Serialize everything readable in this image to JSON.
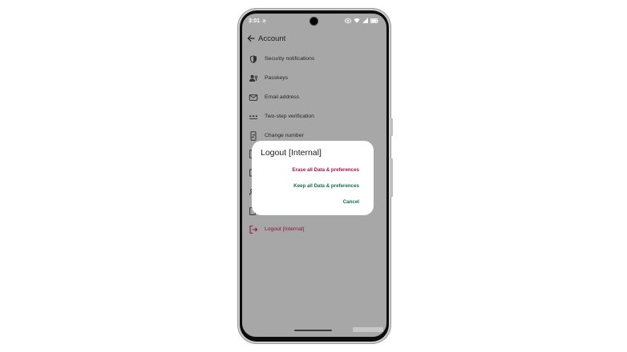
{
  "status_bar": {
    "time": "3:01",
    "notif_glyph": "≷"
  },
  "app_bar": {
    "back_icon": "arrow-left-icon",
    "title": "Account"
  },
  "menu": {
    "items": [
      {
        "label": "Security notifications",
        "icon": "shield-icon"
      },
      {
        "label": "Passkeys",
        "icon": "passkey-person-icon"
      },
      {
        "label": "Email address",
        "icon": "envelope-icon"
      },
      {
        "label": "Two-step verification",
        "icon": "pin-dots-icon"
      },
      {
        "label": "Change number",
        "icon": "phone-swap-icon"
      },
      {
        "label": "Logout [Internal]",
        "icon": "logout-icon",
        "color": "#8a1538"
      }
    ]
  },
  "dialog": {
    "title": "Logout [Internal]",
    "erase_label": "Erase all Data & preferences",
    "keep_label": "Keep all Data & preferences",
    "cancel_label": "Cancel",
    "erase_color": "#a3153f",
    "accent_color": "#196b49"
  },
  "colors": {
    "scrim": "#a7a7a7",
    "dialog_bg": "#ffffff"
  }
}
